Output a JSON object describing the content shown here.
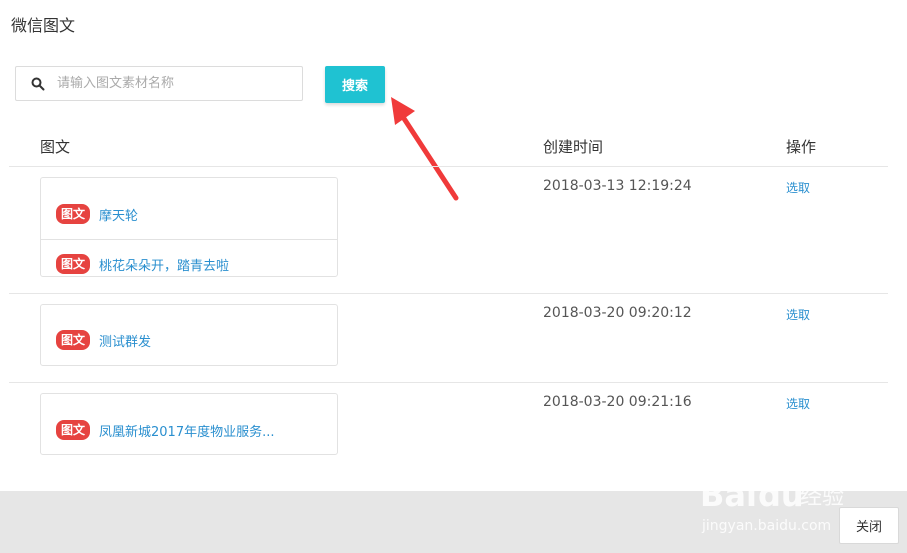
{
  "header": {
    "title": "微信图文"
  },
  "search": {
    "placeholder": "请输入图文素材名称",
    "value": "",
    "button_label": "搜索"
  },
  "table": {
    "columns": [
      "图文",
      "创建时间",
      "操作"
    ],
    "rows": [
      {
        "items": [
          {
            "badge": "图文",
            "title": "摩天轮"
          },
          {
            "badge": "图文",
            "title": "桃花朵朵开，踏青去啦"
          }
        ],
        "created": "2018-03-13 12:19:24",
        "action": "选取"
      },
      {
        "items": [
          {
            "badge": "图文",
            "title": "测试群发"
          }
        ],
        "created": "2018-03-20 09:20:12",
        "action": "选取"
      },
      {
        "items": [
          {
            "badge": "图文",
            "title": "凤凰新城2017年度物业服务..."
          }
        ],
        "created": "2018-03-20 09:21:16",
        "action": "选取"
      }
    ]
  },
  "footer": {
    "close_label": "关闭"
  },
  "watermark": {
    "text": "Baidu经验",
    "url": "jingyan.baidu.com"
  },
  "colors": {
    "accent": "#1fc2d2",
    "badge": "#e64340",
    "link": "#2a8fcf",
    "annotation_arrow": "#f03a3a"
  }
}
